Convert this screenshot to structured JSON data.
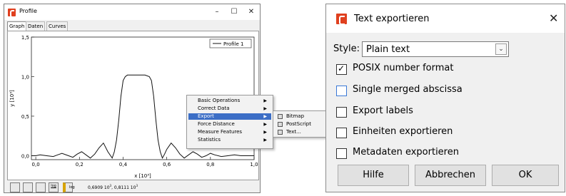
{
  "profile_window": {
    "title": "Profile",
    "controls": {
      "minimize": "–",
      "maximize": "☐",
      "close": "✕"
    },
    "tabs": [
      "Graph",
      "Daten",
      "Curves"
    ],
    "status": {
      "btn_log_x": "log",
      "btn_log_y": "log",
      "coords_x": "0,6909 10",
      "coords_sep": ", 0,8111 10",
      "exp": "3"
    },
    "context_menu": {
      "items": [
        "Basic Operations",
        "Correct Data",
        "Export",
        "Force Distance",
        "Measure Features",
        "Statistics"
      ],
      "highlighted": "Export",
      "submenu": [
        "Bitmap",
        "PostScript",
        "Text..."
      ]
    }
  },
  "chart_data": {
    "type": "line",
    "xlabel": "x [10³]",
    "ylabel": "y [10³]",
    "xlim": [
      -0.02,
      1.0
    ],
    "ylim": [
      -0.05,
      1.5
    ],
    "xticks": [
      "0,0",
      "0,2",
      "0,4",
      "0,6",
      "0,8",
      "1,0"
    ],
    "xtick_values": [
      0.0,
      0.2,
      0.4,
      0.6,
      0.8,
      1.0
    ],
    "yticks": [
      "0,0",
      "0,5",
      "1,0",
      "1,5"
    ],
    "ytick_values": [
      0.0,
      0.5,
      1.0,
      1.5
    ],
    "legend": "Profile 1",
    "legend_position": "top-right",
    "grid": false,
    "series": [
      {
        "name": "Profile 1",
        "x": [
          -0.02,
          0.0,
          0.02,
          0.05,
          0.08,
          0.1,
          0.12,
          0.15,
          0.17,
          0.19,
          0.21,
          0.23,
          0.25,
          0.27,
          0.29,
          0.31,
          0.33,
          0.35,
          0.36,
          0.37,
          0.38,
          0.39,
          0.4,
          0.41,
          0.42,
          0.44,
          0.46,
          0.48,
          0.5,
          0.52,
          0.53,
          0.54,
          0.55,
          0.56,
          0.57,
          0.58,
          0.59,
          0.6,
          0.62,
          0.64,
          0.66,
          0.68,
          0.7,
          0.72,
          0.74,
          0.76,
          0.78,
          0.8,
          0.82,
          0.85,
          0.88,
          0.91,
          0.94,
          0.97,
          1.0
        ],
        "y": [
          0.0,
          0.0,
          0.01,
          0.0,
          -0.01,
          0.01,
          0.03,
          0.0,
          -0.02,
          0.02,
          0.05,
          0.01,
          -0.03,
          0.02,
          0.1,
          0.16,
          0.05,
          -0.03,
          0.05,
          0.2,
          0.45,
          0.75,
          0.95,
          1.0,
          1.02,
          1.02,
          1.02,
          1.02,
          1.02,
          1.0,
          0.95,
          0.75,
          0.45,
          0.2,
          0.05,
          -0.03,
          0.02,
          0.08,
          0.16,
          0.1,
          0.02,
          -0.03,
          0.01,
          0.05,
          0.02,
          -0.02,
          0.0,
          0.03,
          0.01,
          -0.01,
          0.0,
          0.01,
          0.0,
          0.0,
          0.0
        ]
      }
    ]
  },
  "dialog": {
    "title": "Text exportieren",
    "close": "✕",
    "style_label": "Style:",
    "style_value": "Plain text",
    "checkboxes": [
      {
        "label": "POSIX number format",
        "checked": true
      },
      {
        "label": "Single merged abscissa",
        "checked": false
      },
      {
        "label": "Export labels",
        "checked": false
      },
      {
        "label": "Einheiten exportieren",
        "checked": false
      },
      {
        "label": "Metadaten exportieren",
        "checked": false
      }
    ],
    "buttons": {
      "help": "Hilfe",
      "cancel": "Abbrechen",
      "ok": "OK"
    }
  },
  "colors": {
    "menu_highlight": "#3c6ec6",
    "checkbox_focus": "#3a78d6",
    "app_icon": "#e0401f"
  }
}
